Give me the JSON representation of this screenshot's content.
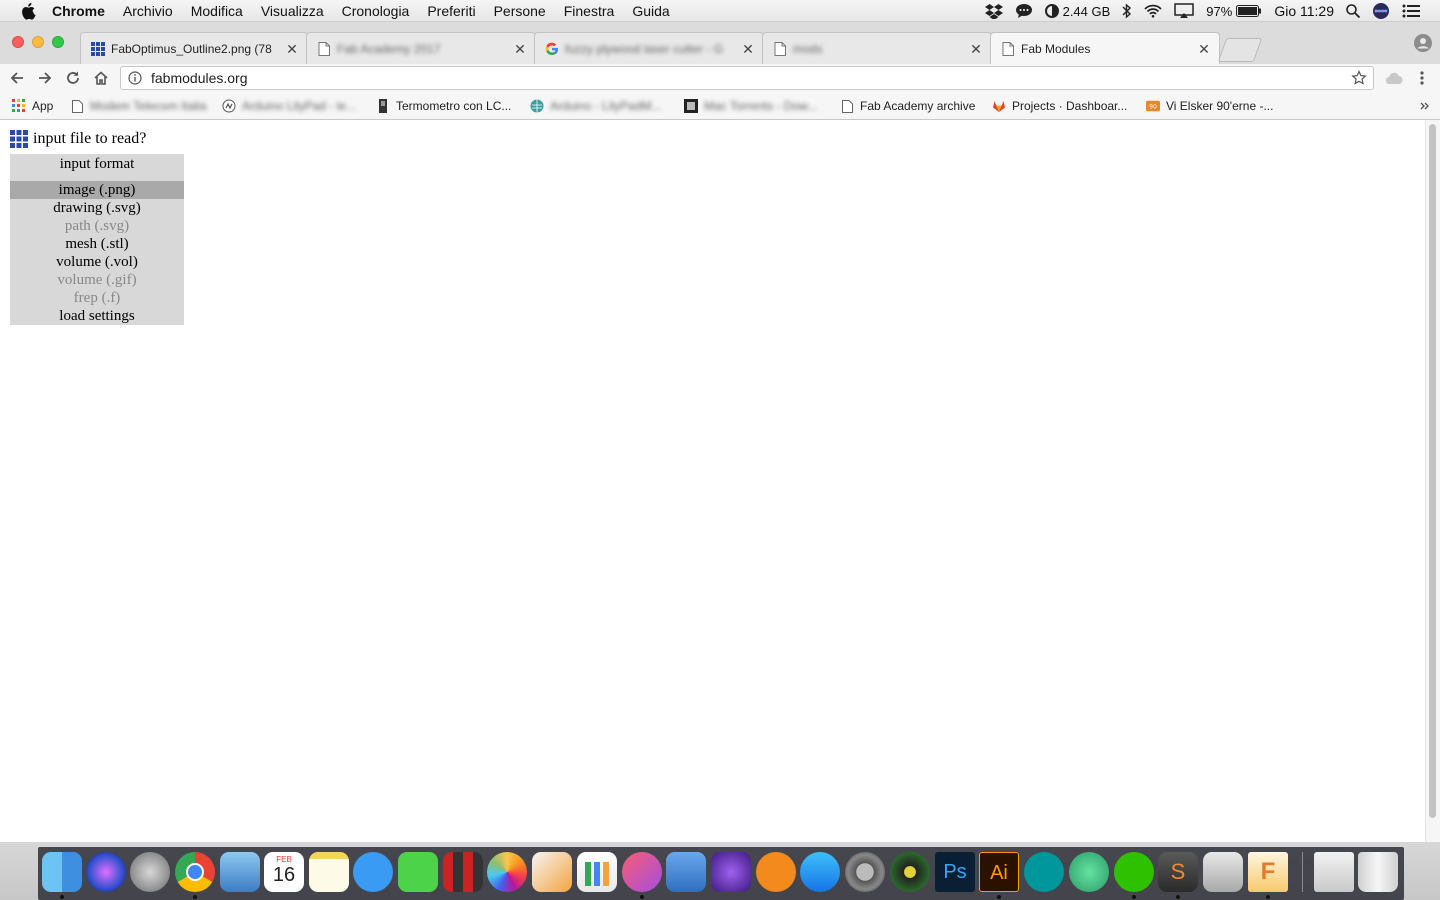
{
  "menubar": {
    "app_name": "Chrome",
    "items": [
      "Archivio",
      "Modifica",
      "Visualizza",
      "Cronologia",
      "Preferiti",
      "Persone",
      "Finestra",
      "Guida"
    ],
    "memory": "2.44 GB",
    "battery": "97%",
    "clock": "Gio 11:29"
  },
  "tabs": [
    {
      "title": "FabOptimus_Outline2.png (78",
      "icon": "grid-favicon",
      "active": false
    },
    {
      "title": "Fab Academy 2017",
      "icon": "page-icon",
      "active": false,
      "blurred": true
    },
    {
      "title": "fuzzy plywood laser cutter - G",
      "icon": "google-icon",
      "active": false,
      "blurred": true
    },
    {
      "title": "mods",
      "icon": "page-icon",
      "active": false,
      "blurred": true
    },
    {
      "title": "Fab Modules",
      "icon": "page-icon",
      "active": true
    }
  ],
  "address": {
    "url": "fabmodules.org"
  },
  "bookmarks": [
    {
      "label": "App",
      "icon": "apps-grid-icon"
    },
    {
      "label": "Modem Telecom Italia",
      "icon": "page-icon",
      "blurred": true
    },
    {
      "label": "Arduino LilyPad - le...",
      "icon": "arduino-icon",
      "blurred": true
    },
    {
      "label": "Termometro con LC...",
      "icon": "thermometer-icon"
    },
    {
      "label": "Arduino - LilyPadM...",
      "icon": "globe-icon",
      "blurred": true
    },
    {
      "label": "Mac Torrents - Dow...",
      "icon": "dark-square-icon",
      "blurred": true
    },
    {
      "label": "Fab Academy archive",
      "icon": "page-icon"
    },
    {
      "label": "Projects · Dashboar...",
      "icon": "gitlab-icon"
    },
    {
      "label": "Vi Elsker 90'erne -...",
      "icon": "folder-tag-icon"
    }
  ],
  "page": {
    "header": "input file to read?",
    "menu_title": "input format",
    "options": [
      {
        "label": "image (.png)",
        "state": "selected"
      },
      {
        "label": "drawing (.svg)",
        "state": "enabled"
      },
      {
        "label": "path (.svg)",
        "state": "disabled"
      },
      {
        "label": "mesh (.stl)",
        "state": "enabled"
      },
      {
        "label": "volume (.vol)",
        "state": "enabled"
      },
      {
        "label": "volume (.gif)",
        "state": "disabled"
      },
      {
        "label": "frep (.f)",
        "state": "disabled"
      },
      {
        "label": "load settings",
        "state": "enabled"
      }
    ]
  },
  "dock": {
    "calendar_day": "16",
    "calendar_month": "FEB",
    "apps": [
      "finder",
      "siri",
      "launchpad",
      "chrome",
      "preview",
      "calendar",
      "notes",
      "messages-bubble",
      "facetime",
      "photo-booth",
      "photos",
      "pages",
      "numbers",
      "itunes",
      "keynote",
      "imovie",
      "ibooks",
      "app-store",
      "system-preferences",
      "inkscape",
      "photoshop",
      "illustrator",
      "arduino",
      "atom",
      "wechat",
      "sublime",
      "archive-utility",
      "fusion-360",
      "files",
      "trash"
    ]
  }
}
